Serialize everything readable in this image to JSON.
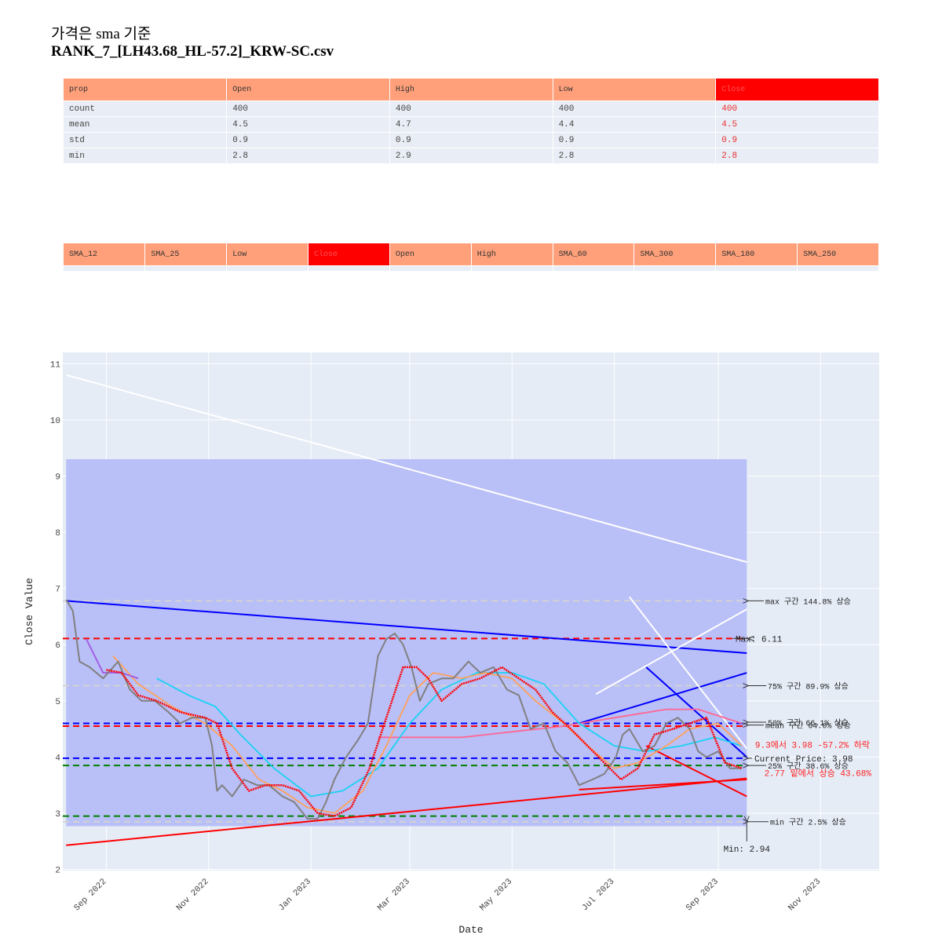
{
  "title": {
    "line1": "가격은 sma 기준",
    "line2": "RANK_7_[LH43.68_HL-57.2]_KRW-SC.csv"
  },
  "table1": {
    "headers": [
      "prop",
      "Open",
      "High",
      "Low",
      "Close"
    ],
    "highlight_col": 4,
    "rows": [
      [
        "count",
        "400",
        "400",
        "400",
        "400"
      ],
      [
        "mean",
        "4.5",
        "4.7",
        "4.4",
        "4.5"
      ],
      [
        "std",
        "0.9",
        "0.9",
        "0.9",
        "0.9"
      ],
      [
        "min",
        "2.8",
        "2.9",
        "2.8",
        "2.8"
      ]
    ]
  },
  "table2": {
    "headers": [
      "SMA_12",
      "SMA_25",
      "Low",
      "Close",
      "Open",
      "High",
      "SMA_60",
      "SMA_300",
      "SMA_180",
      "SMA_250"
    ],
    "highlight_col": 3
  },
  "colors": {
    "price": "#808080",
    "sma_short": "#ff0000",
    "sma_purple": "#a45ee5",
    "sma_orange": "#ffa15a",
    "sma_cyan": "#19d3f3",
    "sma_pink": "#ff6692",
    "band": "#b6bdf7",
    "trend_blue": "#0000ff",
    "trend_red": "#ff0000",
    "plot_bg": "#e5ecf6",
    "header": "#ffa07a",
    "header_highlight": "#ff0000"
  },
  "chart_data": {
    "type": "line",
    "xlabel": "Date",
    "ylabel": "Close Value",
    "x_ticks": [
      "Sep 2022",
      "Nov 2022",
      "Jan 2023",
      "Mar 2023",
      "May 2023",
      "Jul 2023",
      "Sep 2023",
      "Nov 2023"
    ],
    "y_ticks": [
      2,
      3,
      4,
      5,
      6,
      7,
      8,
      9,
      10,
      11
    ],
    "ylim": [
      1.98,
      11.2
    ],
    "xlim": [
      "2022-08-06",
      "2023-12-06"
    ],
    "grid": true,
    "legend": "none",
    "series": [
      {
        "key": "close",
        "x": [
          "2022-08-08",
          "2022-08-12",
          "2022-08-16",
          "2022-08-22",
          "2022-08-30",
          "2022-09-08",
          "2022-09-15",
          "2022-09-22",
          "2022-09-30",
          "2022-10-08",
          "2022-10-15",
          "2022-10-22",
          "2022-10-30",
          "2022-11-03",
          "2022-11-06",
          "2022-11-09",
          "2022-11-15",
          "2022-11-22",
          "2022-11-30",
          "2022-12-07",
          "2022-12-15",
          "2022-12-22",
          "2022-12-30",
          "2023-01-05",
          "2023-01-10",
          "2023-01-15",
          "2023-01-22",
          "2023-01-29",
          "2023-02-04",
          "2023-02-10",
          "2023-02-15",
          "2023-02-20",
          "2023-02-25",
          "2023-03-02",
          "2023-03-07",
          "2023-03-12",
          "2023-03-20",
          "2023-03-27",
          "2023-04-05",
          "2023-04-12",
          "2023-04-20",
          "2023-04-28",
          "2023-05-05",
          "2023-05-12",
          "2023-05-20",
          "2023-05-27",
          "2023-06-03",
          "2023-06-10",
          "2023-06-18",
          "2023-06-25",
          "2023-07-02",
          "2023-07-06",
          "2023-07-10",
          "2023-07-18",
          "2023-07-25",
          "2023-08-01",
          "2023-08-08",
          "2023-08-15",
          "2023-08-20",
          "2023-08-25",
          "2023-09-01",
          "2023-09-08",
          "2023-09-15"
        ],
        "values": [
          6.8,
          6.6,
          5.7,
          5.6,
          5.4,
          5.7,
          5.2,
          5.0,
          5.0,
          4.8,
          4.6,
          4.7,
          4.7,
          4.2,
          3.4,
          3.5,
          3.3,
          3.6,
          3.5,
          3.5,
          3.3,
          3.2,
          2.9,
          2.9,
          3.2,
          3.6,
          4.0,
          4.3,
          4.6,
          5.8,
          6.1,
          6.2,
          6.0,
          5.6,
          5.0,
          5.3,
          5.4,
          5.4,
          5.7,
          5.5,
          5.6,
          5.2,
          5.1,
          4.5,
          4.6,
          4.1,
          3.9,
          3.5,
          3.6,
          3.7,
          4.0,
          4.4,
          4.5,
          4.1,
          4.2,
          4.6,
          4.7,
          4.5,
          4.1,
          4.0,
          4.1,
          3.8,
          3.8
        ]
      },
      {
        "key": "sma_short",
        "x": [
          "2022-09-01",
          "2022-09-10",
          "2022-09-20",
          "2022-10-01",
          "2022-10-15",
          "2022-10-30",
          "2022-11-06",
          "2022-11-15",
          "2022-11-25",
          "2022-12-05",
          "2022-12-15",
          "2022-12-25",
          "2023-01-05",
          "2023-01-15",
          "2023-01-25",
          "2023-02-05",
          "2023-02-15",
          "2023-02-25",
          "2023-03-05",
          "2023-03-12",
          "2023-03-20",
          "2023-04-01",
          "2023-04-12",
          "2023-04-25",
          "2023-05-05",
          "2023-05-15",
          "2023-05-25",
          "2023-06-05",
          "2023-06-15",
          "2023-06-25",
          "2023-07-05",
          "2023-07-15",
          "2023-07-25",
          "2023-08-05",
          "2023-08-15",
          "2023-08-25",
          "2023-09-05",
          "2023-09-15"
        ],
        "values": [
          5.55,
          5.5,
          5.1,
          5.0,
          4.8,
          4.7,
          4.6,
          3.8,
          3.4,
          3.5,
          3.5,
          3.4,
          3.0,
          2.95,
          3.1,
          3.8,
          4.7,
          5.6,
          5.6,
          5.4,
          5.0,
          5.3,
          5.4,
          5.6,
          5.4,
          5.2,
          4.8,
          4.5,
          4.2,
          3.9,
          3.6,
          3.8,
          4.4,
          4.5,
          4.6,
          4.7,
          3.9,
          3.8
        ]
      },
      {
        "key": "sma_purple",
        "x": [
          "2022-08-20",
          "2022-08-30",
          "2022-09-10",
          "2022-09-20"
        ],
        "values": [
          6.1,
          5.5,
          5.5,
          5.4
        ]
      },
      {
        "key": "sma_orange",
        "x": [
          "2022-09-05",
          "2022-09-20",
          "2022-10-10",
          "2022-10-30",
          "2022-11-15",
          "2022-12-01",
          "2022-12-15",
          "2022-12-30",
          "2023-01-15",
          "2023-02-01",
          "2023-02-15",
          "2023-03-01",
          "2023-03-15",
          "2023-04-01",
          "2023-04-15",
          "2023-05-01",
          "2023-05-15",
          "2023-06-01",
          "2023-06-15",
          "2023-07-01",
          "2023-07-15",
          "2023-08-01",
          "2023-08-15",
          "2023-09-01",
          "2023-09-15"
        ],
        "values": [
          5.8,
          5.3,
          4.9,
          4.6,
          4.2,
          3.6,
          3.4,
          3.1,
          3.0,
          3.4,
          4.2,
          5.1,
          5.5,
          5.4,
          5.5,
          5.4,
          5.0,
          4.6,
          4.2,
          3.8,
          3.9,
          4.2,
          4.5,
          4.6,
          4.2
        ]
      },
      {
        "key": "sma_cyan",
        "x": [
          "2022-10-01",
          "2022-10-20",
          "2022-11-05",
          "2022-11-20",
          "2022-12-10",
          "2023-01-01",
          "2023-01-20",
          "2023-02-10",
          "2023-03-01",
          "2023-03-20",
          "2023-04-10",
          "2023-05-01",
          "2023-05-20",
          "2023-06-10",
          "2023-07-01",
          "2023-07-20",
          "2023-08-10",
          "2023-08-30",
          "2023-09-15"
        ],
        "values": [
          5.4,
          5.1,
          4.9,
          4.4,
          3.8,
          3.3,
          3.4,
          3.8,
          4.6,
          5.2,
          5.5,
          5.5,
          5.3,
          4.6,
          4.2,
          4.1,
          4.2,
          4.35,
          4.2
        ]
      },
      {
        "key": "sma_pink",
        "x": [
          "2023-02-10",
          "2023-03-01",
          "2023-04-01",
          "2023-05-01",
          "2023-06-01",
          "2023-07-01",
          "2023-08-01",
          "2023-08-20",
          "2023-09-15"
        ],
        "values": [
          4.35,
          4.35,
          4.35,
          4.45,
          4.55,
          4.7,
          4.85,
          4.85,
          4.6
        ]
      }
    ],
    "horizontal_lines": [
      {
        "y": 6.78,
        "color": "#d3d3d3"
      },
      {
        "y": 6.11,
        "color": "#ff0000"
      },
      {
        "y": 5.27,
        "color": "#d3d3d3"
      },
      {
        "y": 4.6,
        "color": "#0000ff"
      },
      {
        "y": 4.55,
        "color": "#ff0000"
      },
      {
        "y": 3.98,
        "color": "#0000ff"
      },
      {
        "y": 3.85,
        "color": "#008000"
      },
      {
        "y": 2.95,
        "color": "#008000"
      },
      {
        "y": 2.85,
        "color": "#d3d3d3"
      }
    ],
    "annotations": [
      {
        "text": "max 구간 144.8% 상승",
        "y": 6.78
      },
      {
        "text": "Max: 6.11",
        "y": 6.11
      },
      {
        "text": "75% 구간 89.9% 상승",
        "y": 5.27
      },
      {
        "text": "50% 구간 66.1% 상승",
        "y": 4.62
      },
      {
        "text": "mean 구간 64.0% 상승",
        "y": 4.57
      },
      {
        "text": "9.3에서 3.98 -57.2% 하락",
        "y": 4.22
      },
      {
        "text": "Current Price: 3.98",
        "y": 3.98
      },
      {
        "text": "25% 구간 38.6% 상승",
        "y": 3.85
      },
      {
        "text": "2.77 밑에서 상승 43.68%",
        "y": 3.72
      },
      {
        "text": "min 구간 2.5% 상승",
        "y": 2.85
      },
      {
        "text": "Min: 2.94",
        "y": 2.5
      }
    ],
    "shaded_band": {
      "y0": 2.77,
      "y1": 9.3,
      "x0": "2022-08-08",
      "x1": "2023-09-18"
    }
  }
}
